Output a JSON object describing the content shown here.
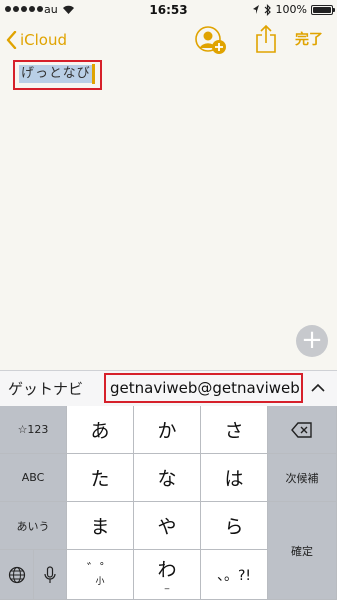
{
  "status_bar": {
    "carrier": "au",
    "time": "16:53",
    "battery_text": "100%",
    "battery_level": 1.0,
    "signal_bars_filled": 5
  },
  "nav_bar": {
    "back_label": "iCloud",
    "done_label": "完了",
    "accent_color": "#e0a300"
  },
  "note": {
    "text": "げっとなび"
  },
  "candidates": {
    "first": "ゲットナビ",
    "second": "getnaviweb@getnaviweb"
  },
  "keyboard": {
    "row1": {
      "left": "☆123",
      "k1": "あ",
      "k2": "か",
      "k3": "さ"
    },
    "row2": {
      "left": "ABC",
      "k1": "た",
      "k2": "な",
      "k3": "は",
      "right": "次候補"
    },
    "row3": {
      "left": "あいう",
      "k1": "ま",
      "k2": "や",
      "k3": "ら",
      "right": "確定"
    },
    "row4": {
      "k1": "゛゜",
      "k1_sub": "小",
      "k2": "わ",
      "k2_sub": "_",
      "k3": "、。?!"
    }
  },
  "icons": {
    "back": "chevron-left-icon",
    "add_people": "add-person-icon",
    "share": "share-icon",
    "plus": "plus-icon",
    "expand": "chevron-up-icon",
    "delete": "backspace-icon",
    "globe": "globe-icon",
    "mic": "microphone-icon"
  }
}
